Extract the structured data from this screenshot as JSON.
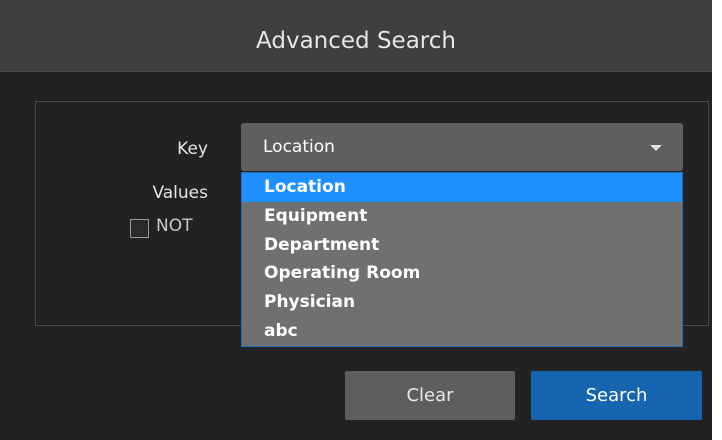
{
  "dialog": {
    "title": "Advanced Search"
  },
  "form": {
    "key_label": "Key",
    "values_label": "Values",
    "not_label": "NOT",
    "not_checked": false
  },
  "key_select": {
    "selected": "Location",
    "options": [
      "Location",
      "Equipment",
      "Department",
      "Operating Room",
      "Physician",
      "abc"
    ],
    "highlighted_index": 0,
    "expanded": true
  },
  "actions": {
    "clear_label": "Clear",
    "search_label": "Search"
  },
  "colors": {
    "header_bg": "#3e3e3e",
    "dialog_bg": "#222222",
    "highlight": "#1e90ff",
    "primary_button": "#1565b0",
    "secondary_button": "#5e5e5e"
  }
}
